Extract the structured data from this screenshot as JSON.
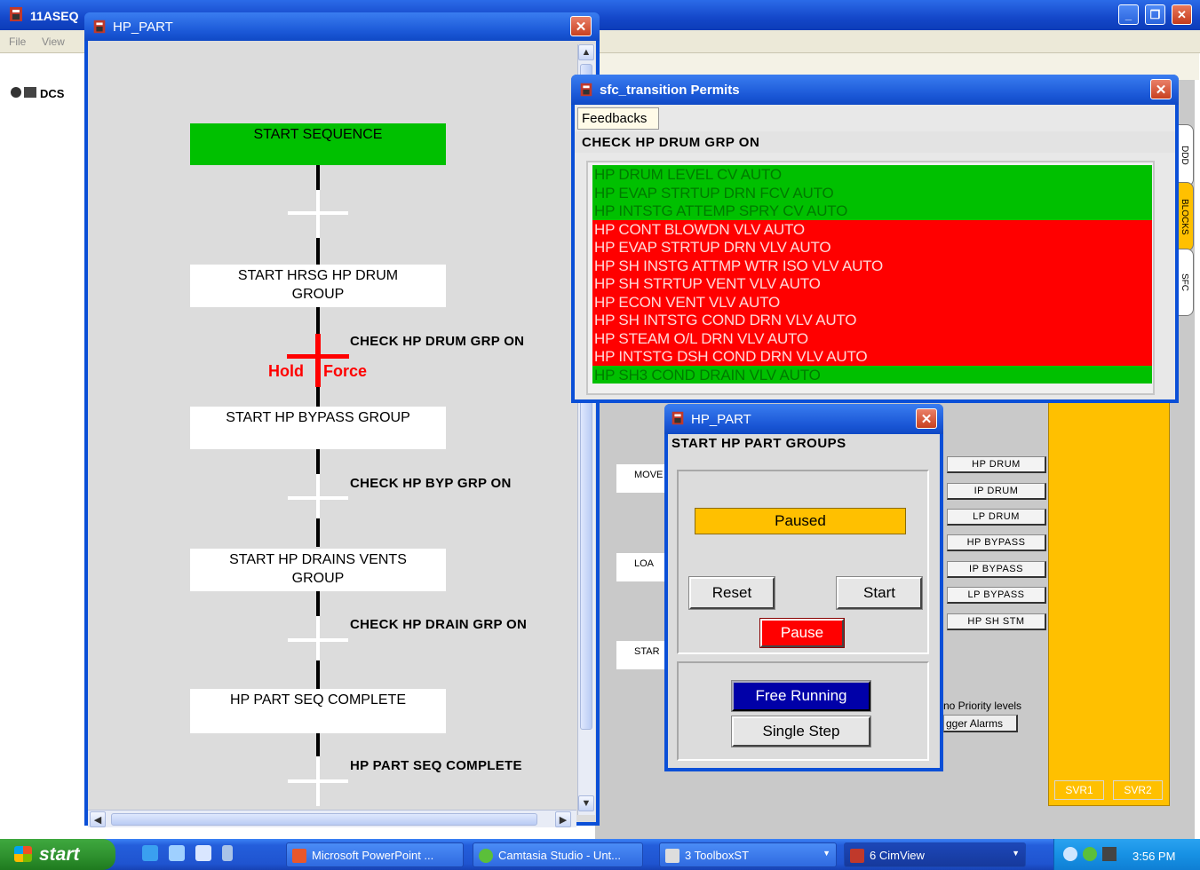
{
  "app": {
    "title": "11ASEQ",
    "menu": [
      "File",
      "View"
    ],
    "dcs_label": "DCS"
  },
  "hp_part_window": {
    "title": "HP_PART",
    "steps": [
      {
        "label": "START SEQUENCE",
        "active": true
      },
      {
        "label": "START HRSG HP DRUM GROUP"
      },
      {
        "label": "START HP BYPASS GROUP"
      },
      {
        "label": "START HP DRAINS VENTS GROUP"
      },
      {
        "label": "HP PART SEQ COMPLETE"
      }
    ],
    "transitions": [
      {
        "label": ""
      },
      {
        "label": "CHECK HP DRUM GRP ON",
        "state": "hold"
      },
      {
        "label": "CHECK HP BYP GRP ON"
      },
      {
        "label": "CHECK HP DRAIN GRP ON"
      },
      {
        "label": "HP PART SEQ COMPLETE"
      }
    ],
    "hold_label": "Hold",
    "force_label": "Force"
  },
  "permits_window": {
    "title": "sfc_transition Permits",
    "tab": "Feedbacks",
    "check_title": "CHECK HP DRUM GRP ON",
    "permits": [
      {
        "label": "HP DRUM LEVEL CV AUTO",
        "ok": true
      },
      {
        "label": "HP EVAP STRTUP DRN FCV AUTO",
        "ok": true
      },
      {
        "label": "HP INTSTG ATTEMP SPRY CV AUTO",
        "ok": true
      },
      {
        "label": "HP CONT BLOWDN VLV AUTO",
        "ok": false
      },
      {
        "label": "HP EVAP STRTUP DRN VLV AUTO",
        "ok": false
      },
      {
        "label": "HP SH INSTG ATTMP WTR ISO VLV AUTO",
        "ok": false
      },
      {
        "label": "HP SH STRTUP VENT VLV AUTO",
        "ok": false
      },
      {
        "label": "HP ECON VENT VLV AUTO",
        "ok": false
      },
      {
        "label": "HP SH INTSTG COND DRN VLV AUTO",
        "ok": false
      },
      {
        "label": "HP STEAM O/L DRN VLV AUTO",
        "ok": false
      },
      {
        "label": "HP INTSTG DSH COND DRN VLV AUTO",
        "ok": false
      },
      {
        "label": "HP SH3 COND DRAIN VLV AUTO",
        "ok": true
      }
    ],
    "colors": {
      "ok": "#00c000",
      "bad": "#ff0000"
    }
  },
  "control_window": {
    "title": "HP_PART",
    "group_title": "START HP PART GROUPS",
    "status": "Paused",
    "reset": "Reset",
    "start": "Start",
    "pause": "Pause",
    "free_running": "Free Running",
    "single_step": "Single Step"
  },
  "background": {
    "group_buttons": [
      "HP DRUM",
      "IP DRUM",
      "LP DRUM",
      "HP BYPASS",
      "IP BYPASS",
      "LP BYPASS",
      "HP SH STM"
    ],
    "mini_boxes": [
      "MOVE",
      "LOA",
      "STAR"
    ],
    "priority_text": "no Priority levels",
    "alarms_text": "gger Alarms",
    "svr": [
      "SVR1",
      "SVR2"
    ],
    "side_tabs": [
      "DDD",
      "BLOCKS",
      "SFC"
    ]
  },
  "taskbar": {
    "start": "start",
    "tasks": [
      {
        "label": "Microsoft PowerPoint ..."
      },
      {
        "label": "Camtasia Studio - Unt..."
      },
      {
        "label": "3 ToolboxST"
      },
      {
        "label": "6 CimView",
        "active": true
      }
    ],
    "clock": "3:56 PM"
  }
}
